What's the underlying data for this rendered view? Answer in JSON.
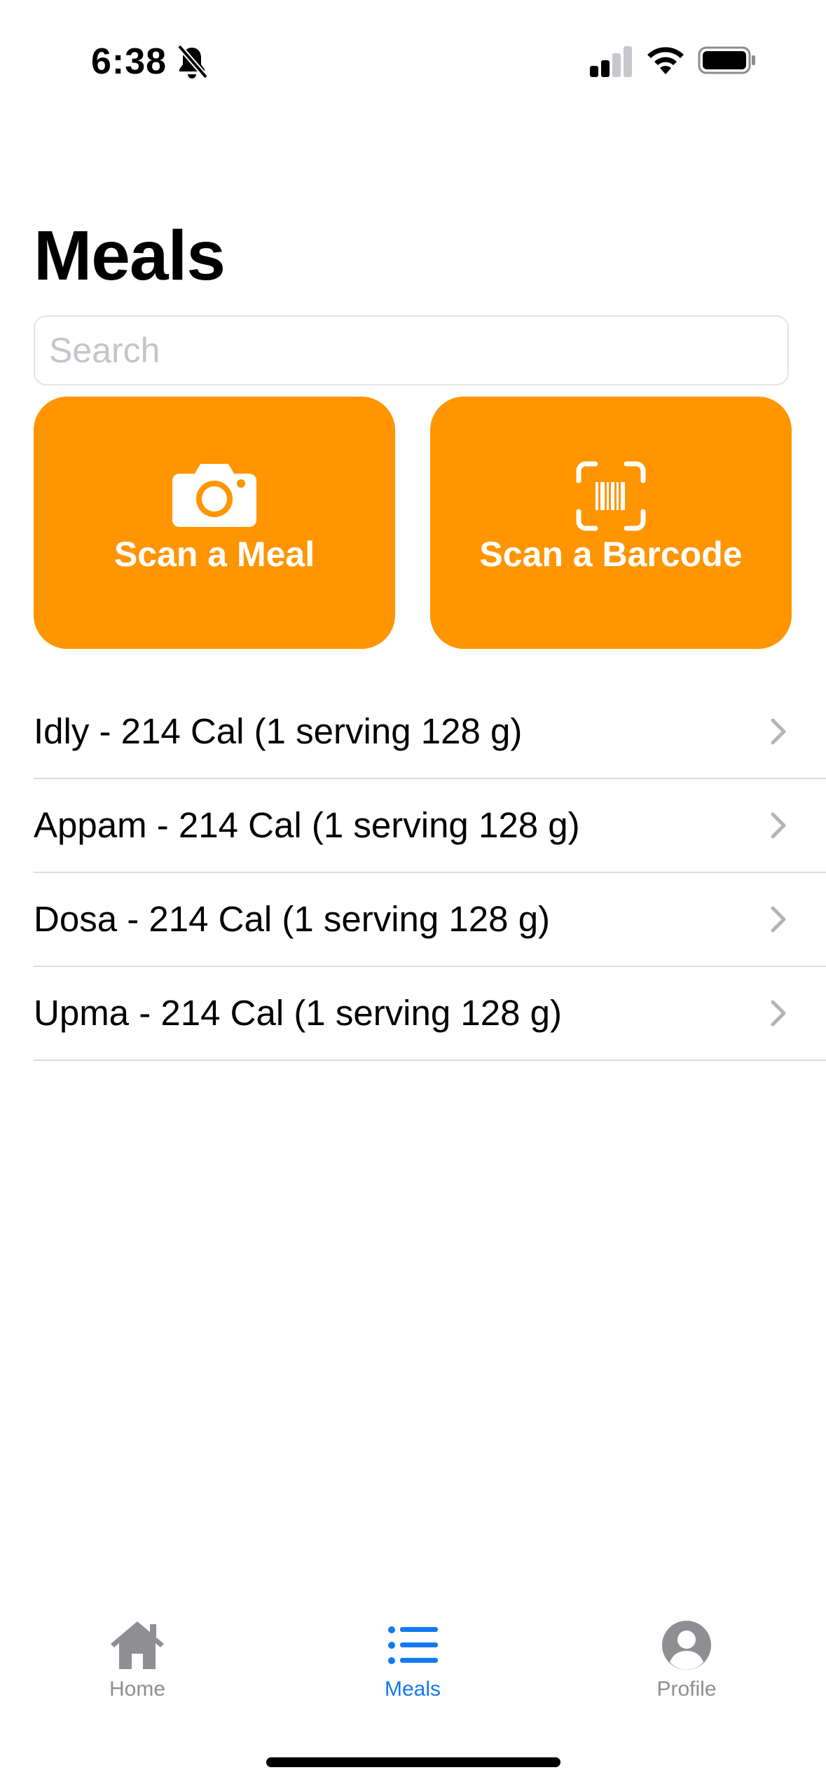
{
  "status_bar": {
    "time": "6:38"
  },
  "page_title": "Meals",
  "search": {
    "placeholder": "Search",
    "value": ""
  },
  "actions": {
    "scan_meal_label": "Scan a Meal",
    "scan_barcode_label": "Scan a Barcode"
  },
  "meals": [
    {
      "label": "Idly - 214 Cal (1 serving 128 g)"
    },
    {
      "label": "Appam - 214 Cal (1 serving 128 g)"
    },
    {
      "label": "Dosa - 214 Cal (1 serving 128 g)"
    },
    {
      "label": "Upma - 214 Cal (1 serving 128 g)"
    }
  ],
  "tabbar": {
    "home": "Home",
    "meals": "Meals",
    "profile": "Profile",
    "active": "meals"
  },
  "colors": {
    "accent": "#ff9500",
    "tab_active": "#1479f0",
    "tab_inactive": "#8e8e93"
  },
  "icons": [
    "bell-slash-icon",
    "cellular-signal-icon",
    "wifi-icon",
    "battery-icon",
    "camera-icon",
    "barcode-viewfinder-icon",
    "chevron-right-icon",
    "house-icon",
    "list-icon",
    "person-circle-icon"
  ]
}
